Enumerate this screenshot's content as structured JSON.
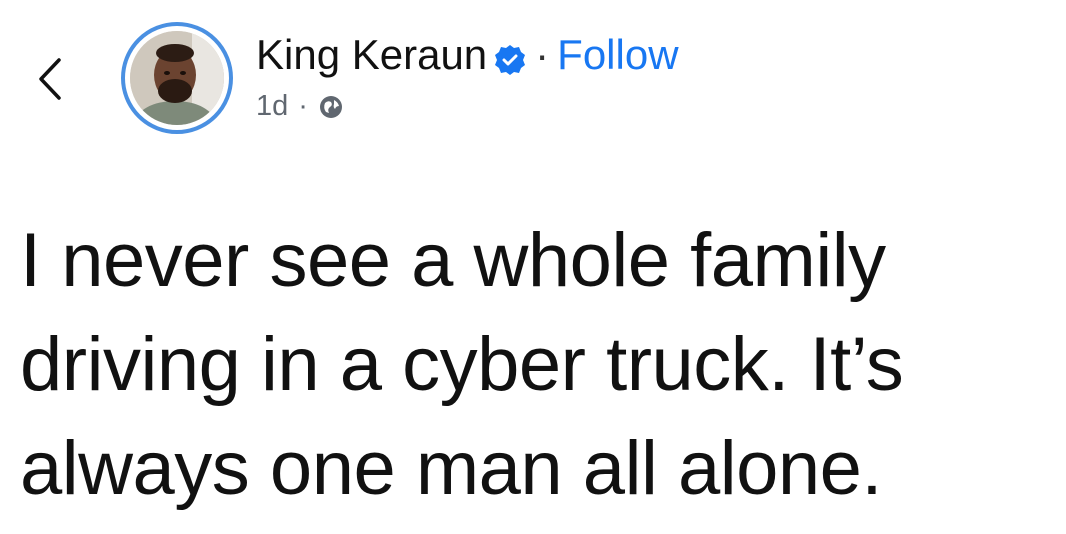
{
  "header": {
    "author_name": "King Keraun",
    "separator": "·",
    "follow_label": "Follow",
    "timestamp": "1d",
    "meta_separator": "·",
    "back_icon": "chevron-left-icon",
    "verified_icon": "verified-badge-icon",
    "audience_icon": "public-globe-icon"
  },
  "post": {
    "lines": [
      "I never see a whole family",
      "driving in a cyber truck. It’s",
      "always one man all alone."
    ]
  },
  "colors": {
    "accent": "#1877f2",
    "avatar_ring": "#4a90e2",
    "text": "#111111",
    "meta": "#606770"
  }
}
